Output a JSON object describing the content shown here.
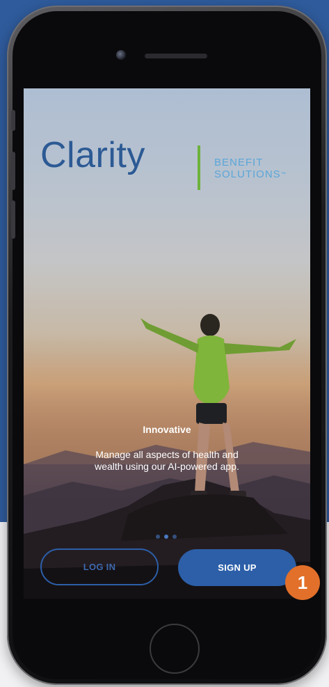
{
  "brand": {
    "name": "Clarity",
    "sub_line1": "BENEFIT",
    "sub_line2": "SOLUTIONS",
    "trademark": "™"
  },
  "carousel": {
    "headline": "Innovative",
    "description_line1": "Manage all aspects of health and",
    "description_line2": "wealth using our AI-powered app.",
    "pages": 3,
    "active_page": 2
  },
  "actions": {
    "login_label": "LOG IN",
    "signup_label": "SIGN UP"
  },
  "annotation": {
    "badge_number": "1"
  },
  "colors": {
    "brand_blue": "#2c5a94",
    "accent_green": "#6db23c",
    "sub_blue": "#5aa6d8",
    "button_blue": "#2c5fa8",
    "badge_orange": "#e2702a",
    "page_background": "#2f5b9c"
  },
  "icons": [
    "front-camera-icon",
    "speaker-icon",
    "home-button-icon"
  ]
}
